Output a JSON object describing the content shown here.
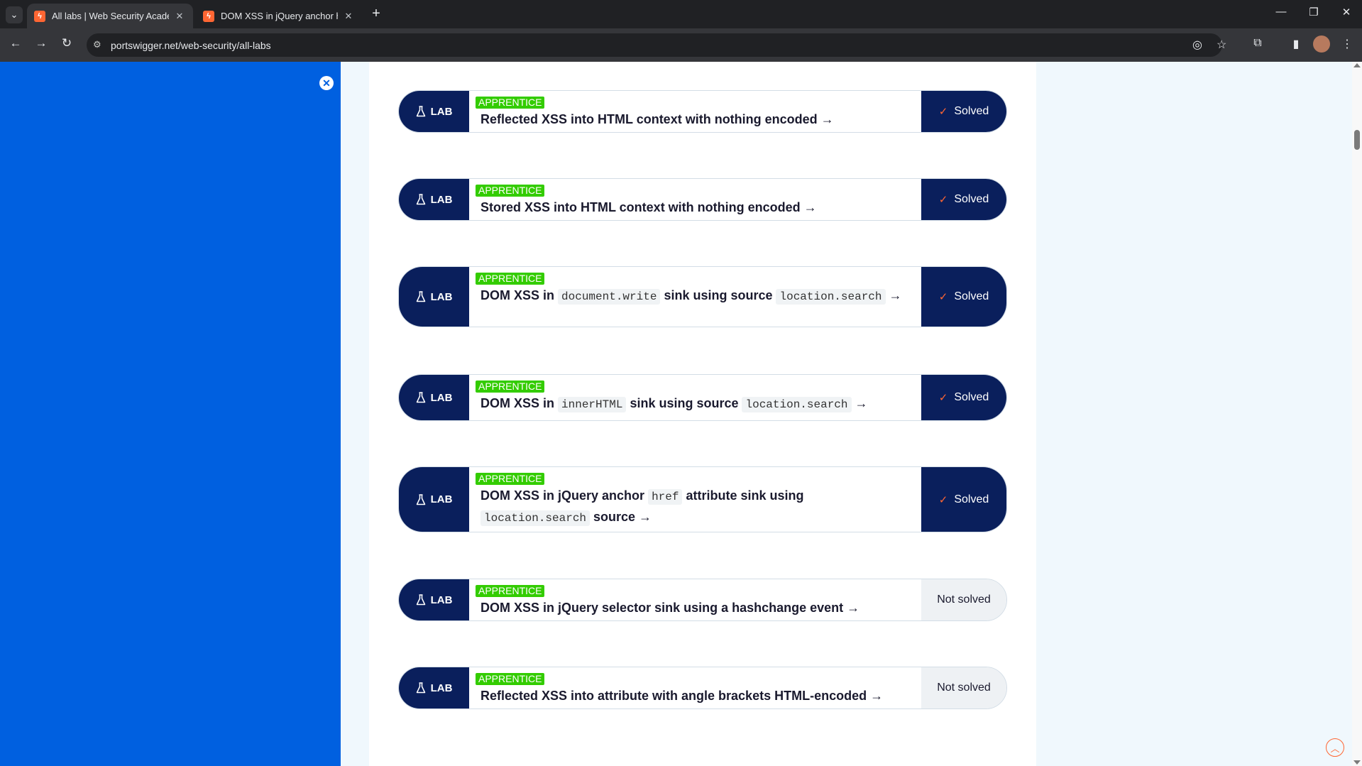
{
  "browser": {
    "tabs": [
      {
        "title": "All labs | Web Security Academy",
        "active": true
      },
      {
        "title": "DOM XSS in jQuery anchor href",
        "active": false
      }
    ],
    "url": "portswigger.net/web-security/all-labs"
  },
  "labs": [
    {
      "badge": "LAB",
      "level": "APPRENTICE",
      "title_html": "Reflected XSS into HTML context with nothing encoded →",
      "status": "Solved",
      "solved": true
    },
    {
      "badge": "LAB",
      "level": "APPRENTICE",
      "title_html": "Stored XSS into HTML context with nothing encoded →",
      "status": "Solved",
      "solved": true
    },
    {
      "badge": "LAB",
      "level": "APPRENTICE",
      "title_parts": [
        [
          "DOM XSS in ",
          false
        ],
        [
          "document.write",
          true
        ],
        [
          " sink using source ",
          false
        ],
        [
          "location.search",
          true
        ],
        [
          " →",
          false
        ]
      ],
      "status": "Solved",
      "solved": true
    },
    {
      "badge": "LAB",
      "level": "APPRENTICE",
      "title_parts": [
        [
          "DOM XSS in ",
          false
        ],
        [
          "innerHTML",
          true
        ],
        [
          " sink using source ",
          false
        ],
        [
          "location.search",
          true
        ],
        [
          " →",
          false
        ]
      ],
      "status": "Solved",
      "solved": true
    },
    {
      "badge": "LAB",
      "level": "APPRENTICE",
      "title_parts": [
        [
          "DOM XSS in jQuery anchor ",
          false
        ],
        [
          "href",
          true
        ],
        [
          " attribute sink using ",
          false
        ],
        [
          "location.search",
          true
        ],
        [
          " source →",
          false
        ]
      ],
      "status": "Solved",
      "solved": true
    },
    {
      "badge": "LAB",
      "level": "APPRENTICE",
      "title_html": "DOM XSS in jQuery selector sink using a hashchange event →",
      "status": "Not solved",
      "solved": false
    },
    {
      "badge": "LAB",
      "level": "APPRENTICE",
      "title_html": "Reflected XSS into attribute with angle brackets HTML-encoded →",
      "status": "Not solved",
      "solved": false
    }
  ],
  "colors": {
    "sidebar": "#0060e0",
    "lab_badge": "#0a1f5c",
    "level_badge": "#33cc00",
    "check": "#ff6633"
  }
}
